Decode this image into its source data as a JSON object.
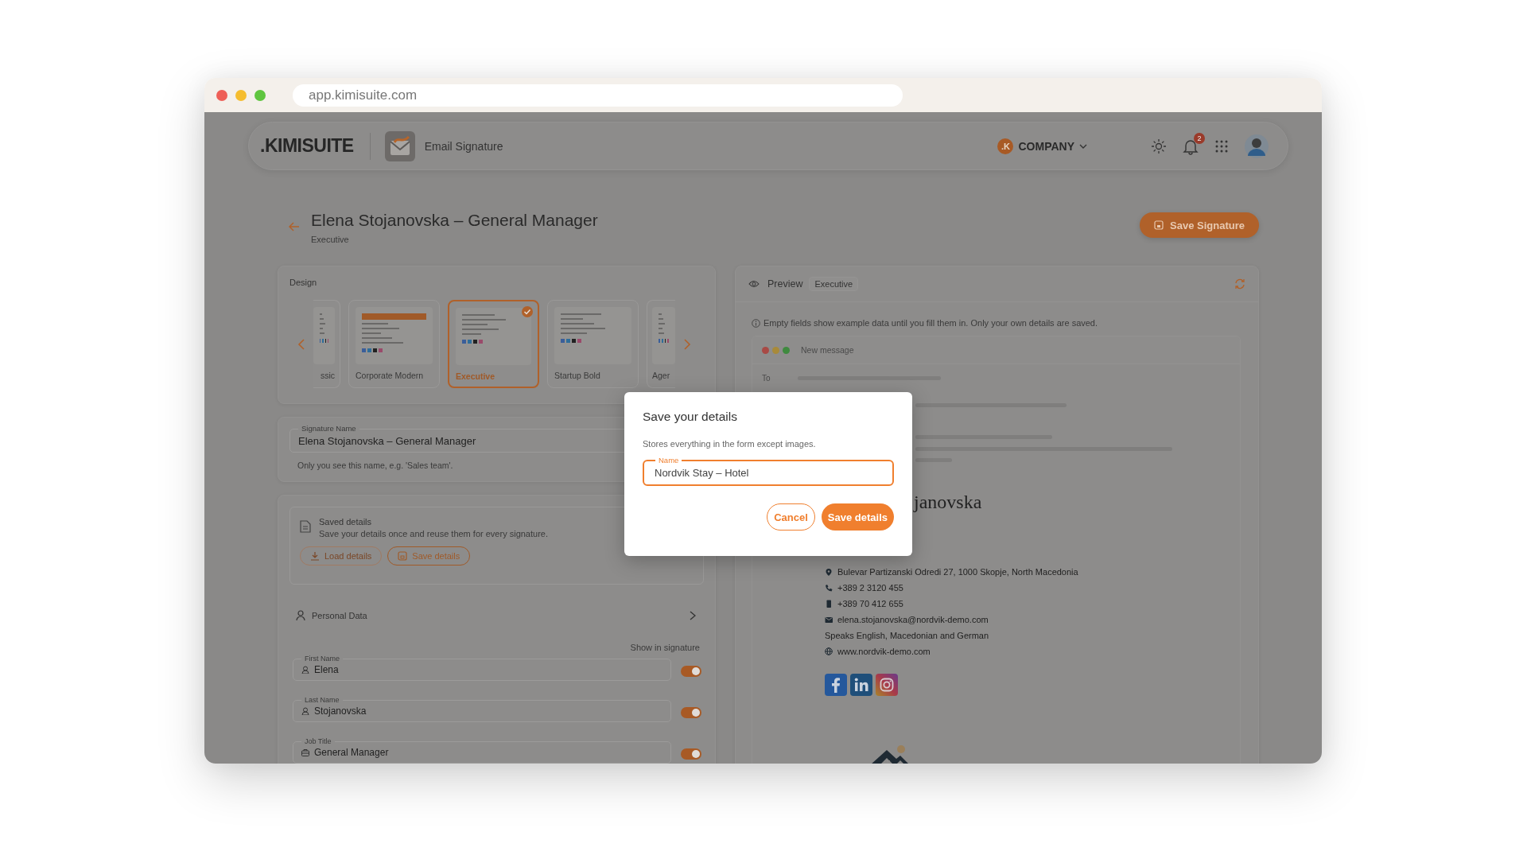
{
  "browser": {
    "url": "app.kimisuite.com"
  },
  "header": {
    "logo": ".KIMISUITE",
    "app_name": "Email Signature",
    "company": {
      "badge": ".K",
      "label": "COMPANY"
    },
    "notifications": "2"
  },
  "page": {
    "title": "Elena Stojanovska – General Manager",
    "subtitle": "Executive",
    "save_button": "Save Signature"
  },
  "design": {
    "label": "Design",
    "templates": [
      {
        "name": "ssic",
        "kind": "cut_left",
        "selected": false
      },
      {
        "name": "Corporate Modern",
        "kind": "full",
        "selected": false
      },
      {
        "name": "Executive",
        "kind": "full",
        "selected": true
      },
      {
        "name": "Startup Bold",
        "kind": "full",
        "selected": false
      },
      {
        "name": "Ager",
        "kind": "cut_right",
        "selected": false
      }
    ]
  },
  "signature_name": {
    "label": "Signature Name",
    "value": "Elena Stojanovska – General Manager",
    "hint": "Only you see this name, e.g. 'Sales team'."
  },
  "saved_details": {
    "title": "Saved details",
    "description": "Save your details once and reuse them for every signature.",
    "buttons": [
      {
        "label": "Load details",
        "kind": "load",
        "disabled": true
      },
      {
        "label": "Save details",
        "kind": "save",
        "disabled": false
      }
    ]
  },
  "personal_data": {
    "title": "Personal Data",
    "show_label": "Show in signature",
    "fields": [
      {
        "label": "First Name",
        "value": "Elena",
        "kind": "person",
        "on": true
      },
      {
        "label": "Last Name",
        "value": "Stojanovska",
        "kind": "person",
        "on": true
      },
      {
        "label": "Job Title",
        "value": "General Manager",
        "kind": "briefcase",
        "on": true
      }
    ]
  },
  "preview": {
    "title": "Preview",
    "template": "Executive",
    "notice": "Empty fields show example data until you fill them in. Only your own details are saved.",
    "mail": {
      "window_title": "New message",
      "to_label": "To",
      "signature": {
        "name": "janovska",
        "lines": [
          {
            "kind": "pin",
            "text": "Bulevar Partizanski Odredi 27, 1000 Skopje, North Macedonia"
          },
          {
            "kind": "phone",
            "text": "+389 2 3120 455"
          },
          {
            "kind": "mobile",
            "text": "+389 70 412 655"
          },
          {
            "kind": "mail",
            "text": "elena.stojanovska@nordvik-demo.com"
          },
          {
            "kind": "plain",
            "text": "Speaks English, Macedonian and German"
          },
          {
            "kind": "globe",
            "text": "www.nordvik-demo.com"
          }
        ],
        "social": [
          {
            "kind": "facebook"
          },
          {
            "kind": "linkedin"
          },
          {
            "kind": "instagram"
          }
        ]
      }
    }
  },
  "modal": {
    "title": "Save your details",
    "description": "Stores everything in the form except images.",
    "field": {
      "label": "Name",
      "value": "Nordvik Stay – Hotel"
    },
    "buttons": [
      {
        "label": "Cancel",
        "kind": "secondary"
      },
      {
        "label": "Save details",
        "kind": "primary"
      }
    ]
  }
}
